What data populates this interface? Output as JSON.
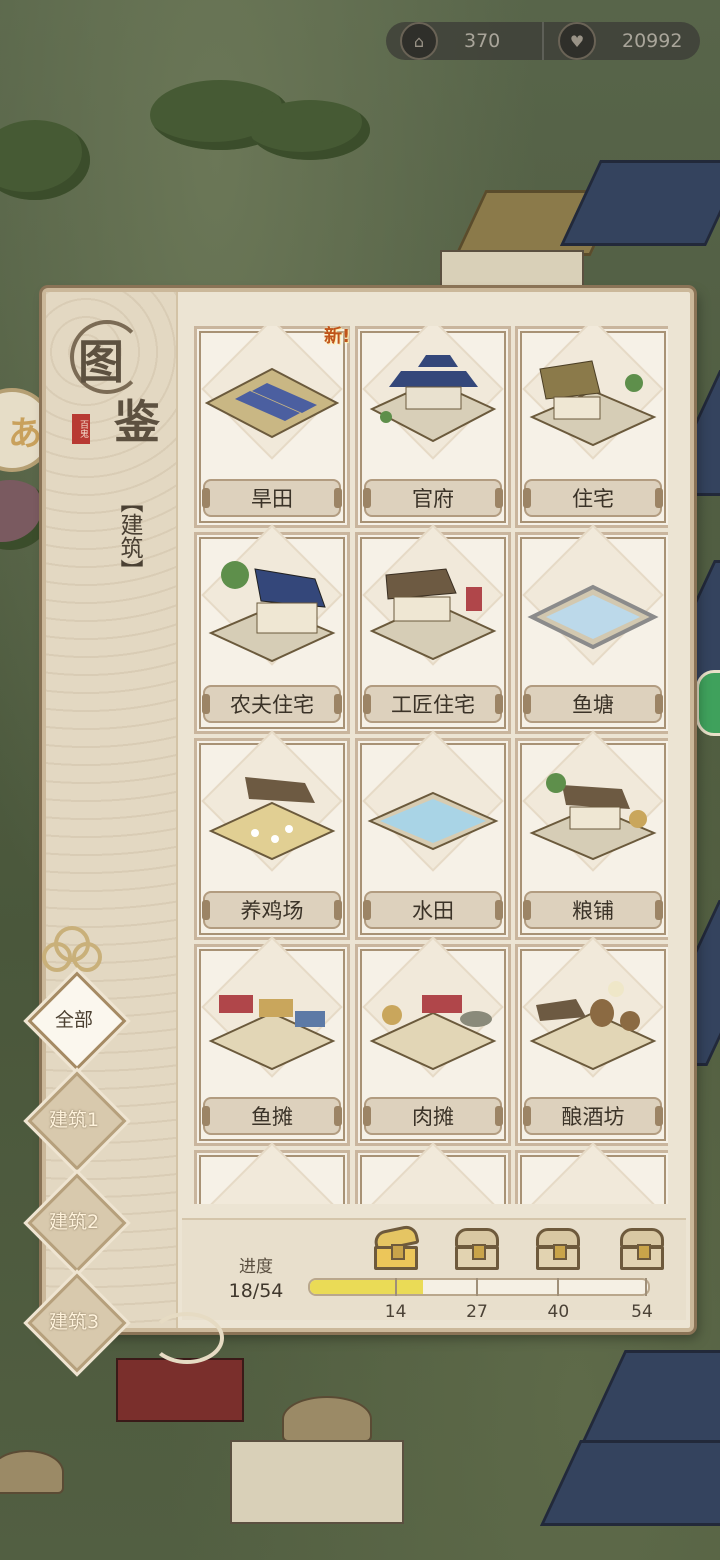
{
  "resources": [
    {
      "icon": "hall-icon",
      "value": "370"
    },
    {
      "icon": "heart-icon",
      "value": "20992"
    }
  ],
  "side_button": {
    "glyph": "あ"
  },
  "codex": {
    "title_chars": [
      "图",
      "鉴"
    ],
    "stamp_text": "百鬼",
    "category": "【建筑】",
    "new_badge": "新!",
    "items": [
      {
        "name": "旱田",
        "art": "dry-field",
        "is_new": true
      },
      {
        "name": "官府",
        "art": "government-office"
      },
      {
        "name": "住宅",
        "art": "residence"
      },
      {
        "name": "农夫住宅",
        "art": "farmer-house"
      },
      {
        "name": "工匠住宅",
        "art": "craftsman-house"
      },
      {
        "name": "鱼塘",
        "art": "fish-pond"
      },
      {
        "name": "养鸡场",
        "art": "chicken-farm"
      },
      {
        "name": "水田",
        "art": "paddy-field"
      },
      {
        "name": "粮铺",
        "art": "grain-shop"
      },
      {
        "name": "鱼摊",
        "art": "fish-stall"
      },
      {
        "name": "肉摊",
        "art": "meat-stall"
      },
      {
        "name": "酿酒坊",
        "art": "brewery"
      }
    ],
    "progress": {
      "label": "进度",
      "value_text": "18/54",
      "current": 18,
      "total": 54,
      "milestones": [
        {
          "value": 14,
          "label": "14",
          "claimable": true
        },
        {
          "value": 27,
          "label": "27"
        },
        {
          "value": 40,
          "label": "40"
        },
        {
          "value": 54,
          "label": "54"
        }
      ]
    }
  },
  "filters": [
    {
      "label": "全部",
      "active": true
    },
    {
      "label": "建筑1"
    },
    {
      "label": "建筑2"
    },
    {
      "label": "建筑3"
    }
  ],
  "colors": {
    "accent_progress": "#eadb56",
    "new_badge": "#c0541b",
    "panel_bg": "#ece4d3"
  }
}
